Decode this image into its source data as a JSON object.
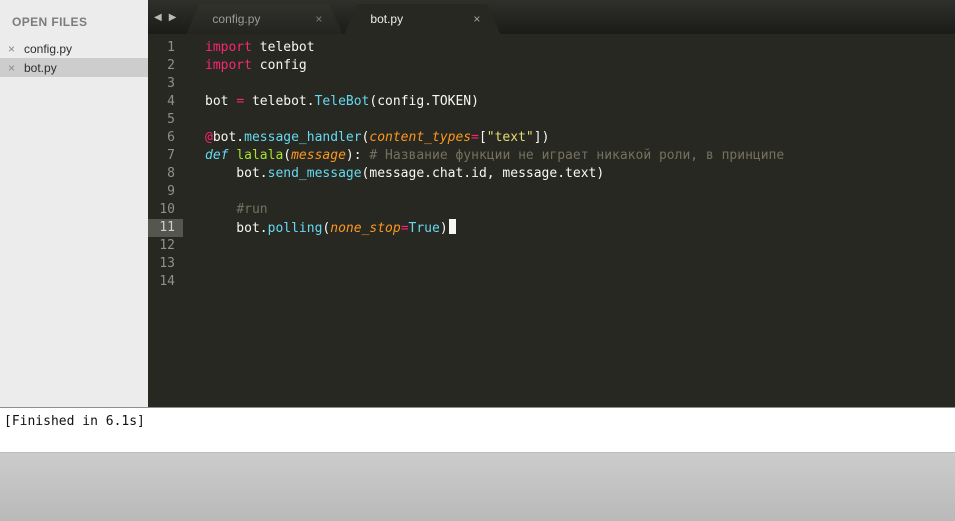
{
  "sidebar": {
    "header": "OPEN FILES",
    "close_glyph": "×",
    "files": [
      {
        "label": "config.py",
        "selected": false
      },
      {
        "label": "bot.py",
        "selected": true
      }
    ]
  },
  "tabbar": {
    "back_glyph": "◀",
    "forward_glyph": "▶",
    "close_glyph": "×",
    "tabs": [
      {
        "label": "config.py",
        "active": false
      },
      {
        "label": "bot.py",
        "active": true
      }
    ]
  },
  "editor": {
    "active_line": 11,
    "lines": [
      {
        "n": 1,
        "t": [
          [
            "kw",
            "import"
          ],
          [
            "txt",
            " telebot"
          ]
        ]
      },
      {
        "n": 2,
        "t": [
          [
            "kw",
            "import"
          ],
          [
            "txt",
            " config"
          ]
        ]
      },
      {
        "n": 3,
        "t": []
      },
      {
        "n": 4,
        "t": [
          [
            "txt",
            "bot "
          ],
          [
            "kw",
            "="
          ],
          [
            "txt",
            " telebot."
          ],
          [
            "fn",
            "TeleBot"
          ],
          [
            "txt",
            "(config.TOKEN)"
          ]
        ]
      },
      {
        "n": 5,
        "t": []
      },
      {
        "n": 6,
        "t": [
          [
            "kw",
            "@"
          ],
          [
            "txt",
            "bot."
          ],
          [
            "fn",
            "message_handler"
          ],
          [
            "txt",
            "("
          ],
          [
            "par",
            "content_types"
          ],
          [
            "kw",
            "="
          ],
          [
            "txt",
            "["
          ],
          [
            "str",
            "\"text\""
          ],
          [
            "txt",
            "])"
          ]
        ]
      },
      {
        "n": 7,
        "t": [
          [
            "defkw",
            "def"
          ],
          [
            "txt",
            " "
          ],
          [
            "fname",
            "lalala"
          ],
          [
            "txt",
            "("
          ],
          [
            "par",
            "message"
          ],
          [
            "txt",
            "): "
          ],
          [
            "cmt",
            "# Название функции не играет никакой роли, в принципе"
          ]
        ]
      },
      {
        "n": 8,
        "t": [
          [
            "txt",
            "    bot."
          ],
          [
            "fn",
            "send_message"
          ],
          [
            "txt",
            "(message.chat.id, message.text)"
          ]
        ]
      },
      {
        "n": 9,
        "t": []
      },
      {
        "n": 10,
        "t": [
          [
            "txt",
            "    "
          ],
          [
            "cmt",
            "#run"
          ]
        ]
      },
      {
        "n": 11,
        "t": [
          [
            "txt",
            "    bot."
          ],
          [
            "fn",
            "polling"
          ],
          [
            "txt",
            "("
          ],
          [
            "par",
            "none_stop"
          ],
          [
            "kw",
            "="
          ],
          [
            "const",
            "True"
          ],
          [
            "txt",
            ")"
          ],
          [
            "caret",
            ""
          ]
        ]
      },
      {
        "n": 12,
        "t": []
      },
      {
        "n": 13,
        "t": []
      },
      {
        "n": 14,
        "t": []
      }
    ]
  },
  "output": {
    "text": "[Finished in 6.1s]"
  },
  "colors": {
    "editor_bg": "#272822",
    "default_text": "#f8f8f2",
    "keyword": "#f92672",
    "function_call": "#66d9ef",
    "string": "#e6db74",
    "comment": "#75715e",
    "parameter": "#fd971f",
    "function_name": "#a6e22e",
    "constant": "#66d9ef",
    "gutter_text": "#8f908a",
    "caret": "#f8f8f0"
  }
}
